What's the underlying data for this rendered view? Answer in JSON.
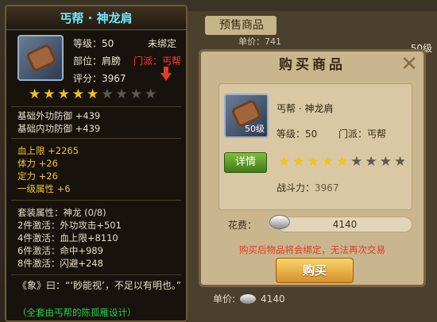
{
  "background": {
    "tab_label": "预售商品",
    "price_top": "单价：741",
    "price_bottom_label": "单价:",
    "price_bottom_value": "4140",
    "level_badge": "50级"
  },
  "tooltip": {
    "title": "丐帮 · 神龙肩",
    "level_label": "等级：",
    "level_value": "50",
    "bind_status": "未绑定",
    "slot_label": "部位：",
    "slot_value": "肩膀",
    "sect_label": "门派：",
    "sect_value": "丐帮",
    "score_label": "评分：",
    "score_value": "3967",
    "stars_on": 5,
    "stars_total": 9,
    "base_outer": "基础外功防御 +439",
    "base_inner": "基础内功防御 +439",
    "hp": "血上限 +2265",
    "stamina": "体力 +26",
    "focus": "定力 +26",
    "primary": "一级属性 +6",
    "set_title": "套装属性：神龙 (0/8)",
    "set_lines": [
      "2件激活：外功攻击+501",
      "4件激活：血上限+8110",
      "6件激活：命中+989",
      "8件激活：闪避+248"
    ],
    "quote": "《象》曰：“‘眇能视’，不足以有明也。”",
    "designer": "（全套由丐帮的陈孤雁设计）"
  },
  "dialog": {
    "title": "购买商品",
    "close": "✕",
    "item_name": "丐帮 · 神龙肩",
    "level_label": "等级：",
    "level_value": "50",
    "sect": "门派：丐帮",
    "icon_level": "50级",
    "detail_button": "详情",
    "stars_on": 5,
    "stars_total": 9,
    "power_label": "战斗力：",
    "power_value": "3967",
    "cost_label": "花费：",
    "cost_value": "4140",
    "warning": "购买后物品将会绑定，无法再次交易",
    "buy_button": "购买"
  }
}
